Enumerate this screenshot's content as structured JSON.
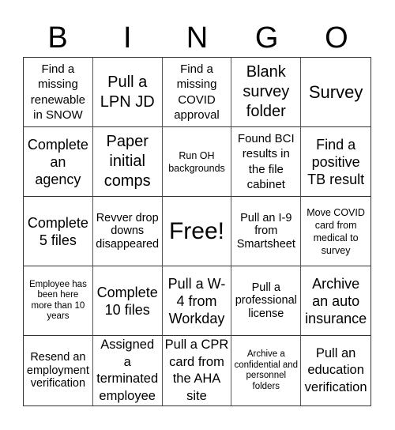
{
  "header": {
    "letters": [
      "B",
      "I",
      "N",
      "G",
      "O"
    ]
  },
  "board": {
    "cells": [
      "Find a missing renewable in SNOW",
      "Pull a LPN JD",
      "Find a missing COVID approval",
      "Blank survey folder",
      "Survey",
      "Complete an agency",
      "Paper initial comps",
      "Run OH backgrounds",
      "Found BCI results in the file cabinet",
      "Find a positive TB result",
      "Complete 5 files",
      "Revver drop downs disappeared",
      "Free!",
      "Pull an I-9 from Smartsheet",
      "Move COVID card from medical to survey",
      "Employee has been here more than 10 years",
      "Complete 10 files",
      "Pull a W-4 from Workday",
      "Pull a professional license",
      "Archive an auto insurance",
      "Resend an employment verification",
      "Assigned a terminated employee",
      "Pull a CPR card from the AHA site",
      "Archive a confidential and personnel folders",
      "Pull an education verification"
    ],
    "free_space_index": 12
  }
}
